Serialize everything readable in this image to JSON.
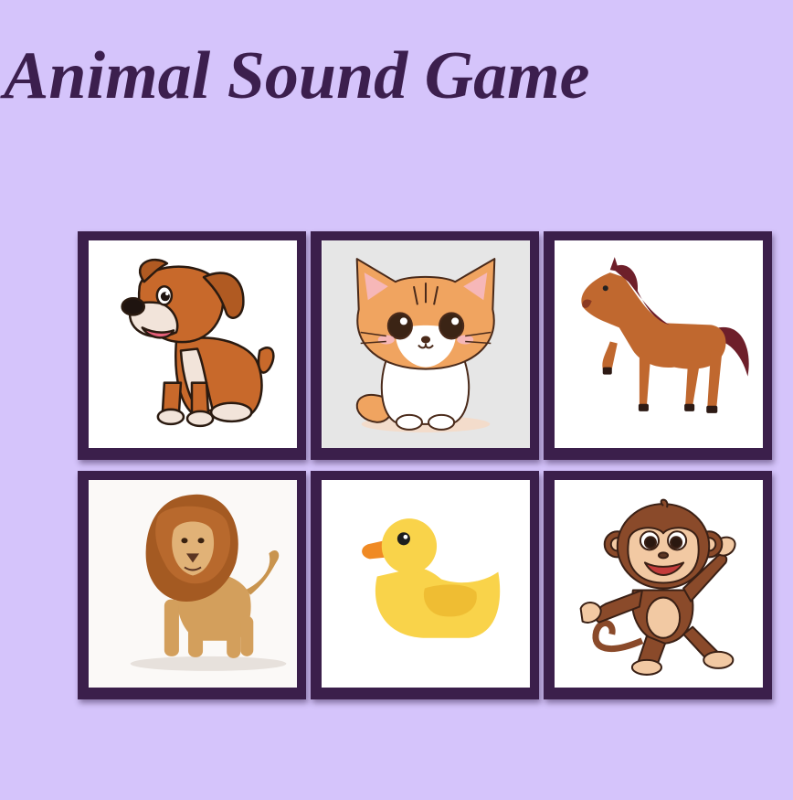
{
  "title": "Animal Sound Game",
  "cards": [
    {
      "animal": "dog",
      "icon": "dog-icon"
    },
    {
      "animal": "cat",
      "icon": "cat-icon"
    },
    {
      "animal": "horse",
      "icon": "horse-icon"
    },
    {
      "animal": "lion",
      "icon": "lion-icon"
    },
    {
      "animal": "duck",
      "icon": "duck-icon"
    },
    {
      "animal": "monkey",
      "icon": "monkey-icon"
    }
  ],
  "colors": {
    "background": "#d5c4fb",
    "title": "#3c1f4e",
    "card_frame": "#3b1f4b",
    "card_face": "#ffffff"
  }
}
